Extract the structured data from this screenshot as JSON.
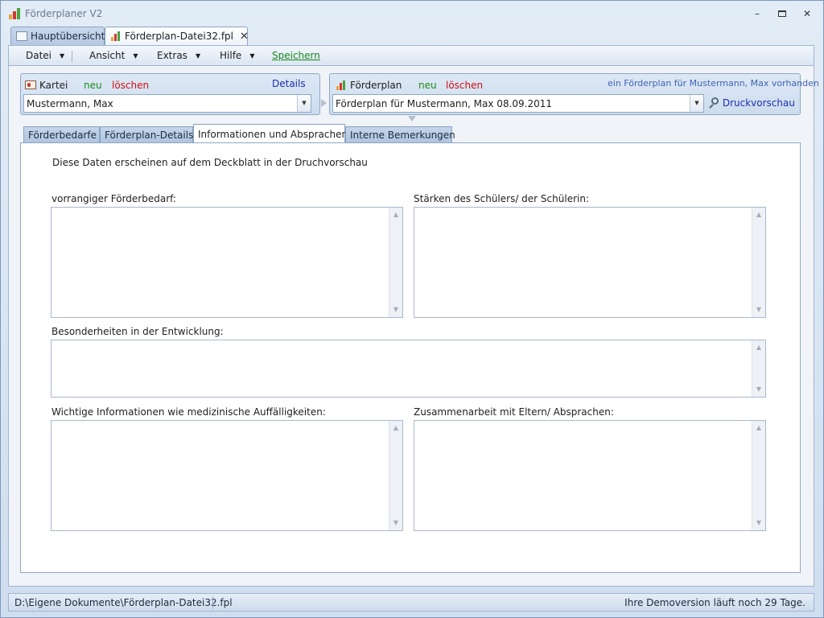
{
  "window": {
    "title": "Förderplaner V2",
    "accent": "#7d98b8"
  },
  "doc_tabs": [
    {
      "label": "Hauptübersicht",
      "icon": "overview-icon",
      "active": false
    },
    {
      "label": "Förderplan-Datei32.fpl",
      "icon": "chart-file-icon",
      "active": true
    }
  ],
  "menu": {
    "datei": "Datei",
    "ansicht": "Ansicht",
    "extras": "Extras",
    "hilfe": "Hilfe",
    "speichern": "Speichern"
  },
  "kartei": {
    "title": "Kartei",
    "new_label": "neu",
    "delete_label": "löschen",
    "details_label": "Details",
    "selected": "Mustermann, Max"
  },
  "foerderplan": {
    "title": "Förderplan",
    "new_label": "neu",
    "delete_label": "löschen",
    "info": "ein Förderplan für Mustermann, Max vorhanden",
    "selected": "Förderplan für Mustermann, Max 08.09.2011",
    "print_preview": "Druckvorschau"
  },
  "inner_tabs": [
    {
      "label": "Förderbedarfe",
      "active": false
    },
    {
      "label": "Förderplan-Details",
      "active": false
    },
    {
      "label": "Informationen und Absprachen",
      "active": true
    },
    {
      "label": "Interne Bemerkungen",
      "active": false
    }
  ],
  "page": {
    "intro": "Diese Daten erscheinen auf dem Deckblatt in der Druchvorschau",
    "fields": {
      "vorrangig": {
        "label": "vorrangiger Förderbedarf:",
        "value": ""
      },
      "staerken": {
        "label": "Stärken des Schülers/ der Schülerin:",
        "value": ""
      },
      "besonderheiten": {
        "label": "Besonderheiten in der Entwicklung:",
        "value": ""
      },
      "wichtige": {
        "label": "Wichtige Informationen wie medizinische Auffälligkeiten:",
        "value": ""
      },
      "zusammenarbeit": {
        "label": "Zusammenarbeit  mit Eltern/ Absprachen:",
        "value": ""
      }
    }
  },
  "status": {
    "path": "D:\\Eigene Dokumente\\Förderplan-Datei32.fpl",
    "demo": "Ihre Demoversion läuft noch 29 Tage."
  }
}
